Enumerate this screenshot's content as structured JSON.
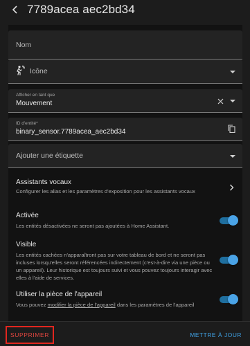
{
  "header": {
    "title": "7789acea aec2bd34",
    "back_icon": "arrow-back-icon"
  },
  "form": {
    "name_field": {
      "placeholder": "Nom",
      "value": ""
    },
    "icon_field": {
      "label": "Icône",
      "icon": "motion-sensor-icon"
    },
    "show_as_field": {
      "label": "Afficher en tant que",
      "value": "Mouvement"
    },
    "entity_id_field": {
      "label": "ID d'entité*",
      "value": "binary_sensor.7789acea_aec2bd34"
    },
    "label_field": {
      "label": "Ajouter une étiquette"
    }
  },
  "voice_assistants": {
    "title": "Assistants vocaux",
    "description": "Configurer les alias et les paramètres d'exposition pour les assistants vocaux"
  },
  "settings": {
    "enabled": {
      "title": "Activée",
      "description": "Les entités désactivées ne seront pas ajoutées à Home Assistant.",
      "on": true
    },
    "visible": {
      "title": "Visible",
      "description": "Les entités cachées n'apparaîtront pas sur votre tableau de bord et ne seront pas incluses lorsqu'elles seront référencées indirectement (c'est-à-dire via une pièce ou un appareil). Leur historique est toujours suivi et vous pouvez toujours interagir avec elles à l'aide de services.",
      "on": true
    },
    "use_device_area": {
      "title": "Utiliser la pièce de l'appareil",
      "description_before": "Vous pouvez ",
      "description_link": "modifier la pièce de l'appareil",
      "description_after": " dans les paramètres de l'appareil",
      "on": true
    }
  },
  "footer": {
    "delete_label": "SUPPRIMER",
    "update_label": "METTRE À JOUR"
  },
  "colors": {
    "accent": "#40a4e8",
    "toggle_track": "#1f6f9f",
    "danger": "#e2261f"
  }
}
